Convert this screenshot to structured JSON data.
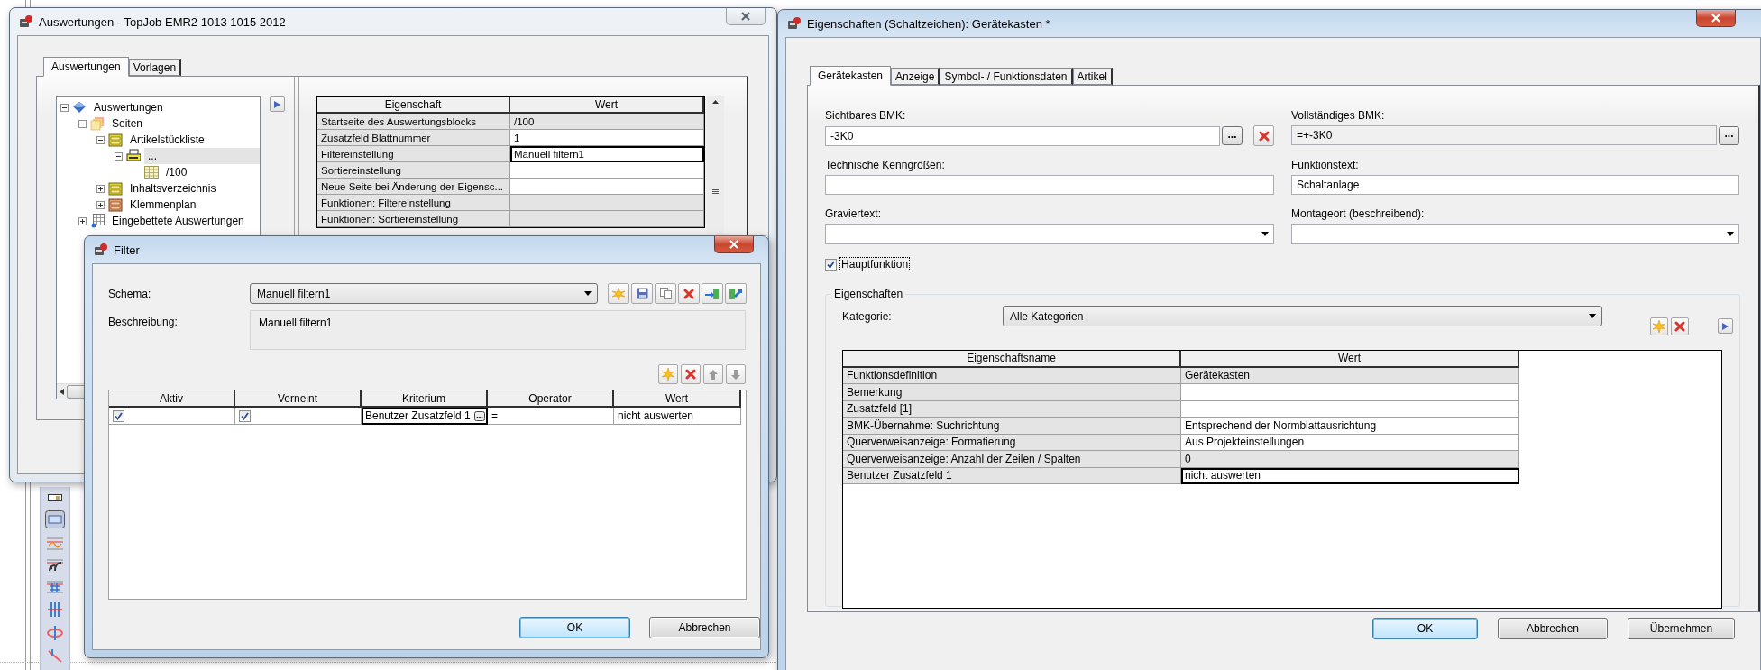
{
  "report_window": {
    "title": "Auswertungen - TopJob EMR2 1013 1015 2012",
    "tabs": [
      {
        "label": "Auswertungen",
        "selected": true
      },
      {
        "label": "Vorlagen",
        "selected": false
      }
    ],
    "tree": [
      {
        "label": "Auswertungen",
        "kind": "root",
        "expanded": true,
        "selected": false,
        "children": [
          {
            "label": "Seiten",
            "kind": "pages",
            "expanded": true,
            "selected": false,
            "children": [
              {
                "label": "Artikelstückliste",
                "kind": "parts-list",
                "expanded": true,
                "selected": false,
                "children": [
                  {
                    "label": "...",
                    "kind": "block",
                    "expanded": true,
                    "selected": true,
                    "children": [
                      {
                        "label": "/100",
                        "kind": "sheet",
                        "selected": false
                      }
                    ]
                  }
                ]
              },
              {
                "label": "Inhaltsverzeichnis",
                "kind": "parts-list",
                "expanded": false,
                "selected": false
              },
              {
                "label": "Klemmenplan",
                "kind": "terminal-plan",
                "expanded": false,
                "selected": false
              }
            ]
          },
          {
            "label": "Eingebettete Auswertungen",
            "kind": "embedded",
            "expanded": false,
            "selected": false
          }
        ]
      }
    ],
    "property_grid": {
      "columns": [
        "Eigenschaft",
        "Wert"
      ],
      "rows": [
        {
          "property": "Startseite des Auswertungsblocks",
          "value": "/100",
          "editable": false,
          "selected": false
        },
        {
          "property": "Zusatzfeld Blattnummer",
          "value": "1",
          "editable": true,
          "selected": false
        },
        {
          "property": "Filtereinstellung",
          "value": "Manuell filtern1",
          "editable": true,
          "selected": true
        },
        {
          "property": "Sortiereinstellung",
          "editable": true,
          "selected": false
        },
        {
          "property": "Neue Seite bei Änderung der Eigensc...",
          "editable": true,
          "selected": false
        },
        {
          "property": "Funktionen: Filtereinstellung",
          "editable": false,
          "selected": false
        },
        {
          "property": "Funktionen: Sortiereinstellung",
          "editable": false,
          "selected": false
        }
      ]
    }
  },
  "filter_dialog": {
    "title": "Filter",
    "schema_label": "Schema:",
    "schema": "Manuell filtern1",
    "description_label": "Beschreibung:",
    "description": "Manuell filtern1",
    "table": {
      "columns": [
        "Aktiv",
        "Verneint",
        "Kriterium",
        "Operator",
        "Wert"
      ],
      "rows": [
        {
          "active": true,
          "negated": true,
          "criterion": "Benutzer Zusatzfeld 1",
          "operator": "=",
          "value": "nicht auswerten",
          "selected": true
        }
      ]
    },
    "buttons": [
      {
        "label": "OK",
        "default": true
      },
      {
        "label": "Abbrechen",
        "default": false
      }
    ]
  },
  "properties_window": {
    "title": "Eigenschaften (Schaltzeichen): Gerätekasten *",
    "tabs": [
      {
        "label": "Gerätekasten",
        "selected": true
      },
      {
        "label": "Anzeige",
        "selected": false
      },
      {
        "label": "Symbol- / Funktionsdaten",
        "selected": false
      },
      {
        "label": "Artikel",
        "selected": false
      }
    ],
    "fields": [
      {
        "label": "Sichtbares BMK:",
        "value": "-3K0",
        "kind": "text",
        "button": "...",
        "clearable": true
      },
      {
        "label": "Vollständiges BMK:",
        "value": "=+-3K0",
        "kind": "readonly",
        "button": "..."
      },
      {
        "label": "Technische Kenngrößen:",
        "kind": "text"
      },
      {
        "label": "Funktionstext:",
        "value": "Schaltanlage",
        "kind": "text"
      },
      {
        "label": "Graviertext:",
        "kind": "combo"
      },
      {
        "label": "Montageort (beschreibend):",
        "kind": "combo"
      }
    ],
    "main_function": {
      "label": "Hauptfunktion",
      "checked": true
    },
    "group": {
      "title": "Eigenschaften",
      "category_label": "Kategorie:",
      "category": "Alle Kategorien",
      "table": {
        "columns": [
          "Eigenschaftsname",
          "Wert"
        ],
        "rows": [
          {
            "property": "Funktionsdefinition",
            "value": "Gerätekasten",
            "editable": false,
            "selected": false
          },
          {
            "property": "Bemerkung",
            "editable": true,
            "selected": false
          },
          {
            "property": "Zusatzfeld [1]",
            "editable": true,
            "selected": false
          },
          {
            "property": "BMK-Übernahme: Suchrichtung",
            "value": "Entsprechend der Normblattausrichtung",
            "editable": true,
            "selected": false
          },
          {
            "property": "Querverweisanzeige: Formatierung",
            "value": "Aus Projekteinstellungen",
            "editable": true,
            "selected": false
          },
          {
            "property": "Querverweisanzeige: Anzahl der Zeilen / Spalten",
            "value": "0",
            "editable": false,
            "selected": false
          },
          {
            "property": "Benutzer Zusatzfeld 1",
            "value": "nicht auswerten",
            "editable": true,
            "selected": true
          }
        ]
      }
    },
    "buttons": [
      {
        "label": "OK",
        "default": true
      },
      {
        "label": "Abbrechen",
        "default": false
      },
      {
        "label": "Übernehmen",
        "default": false
      }
    ]
  }
}
